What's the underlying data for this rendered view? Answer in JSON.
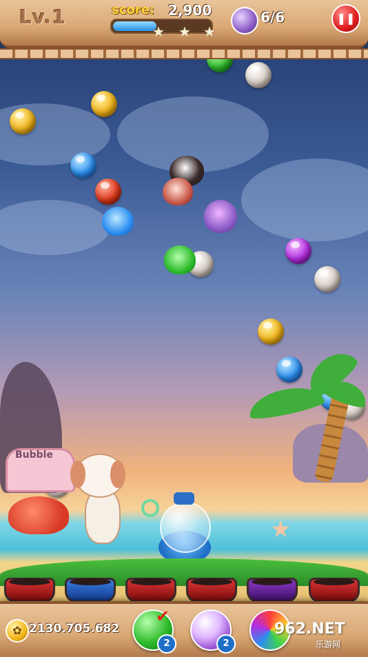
{
  "hud": {
    "level": "Lv.1",
    "score_label": "score:",
    "score_value": "2,900",
    "score_progress": 0.45,
    "stars": 3,
    "birds_count": "6/6",
    "pause_icon": "pause-icon"
  },
  "playfield": {
    "bubbles": [
      {
        "color": "yellow"
      },
      {
        "color": "yellow"
      },
      {
        "color": "blue"
      },
      {
        "color": "red"
      },
      {
        "color": "green"
      },
      {
        "color": "white"
      },
      {
        "color": "purple"
      },
      {
        "color": "white"
      },
      {
        "color": "yellow"
      },
      {
        "color": "blue"
      },
      {
        "color": "blue"
      },
      {
        "color": "white"
      },
      {
        "color": "white"
      },
      {
        "color": "white"
      }
    ],
    "birds_trapped": 5
  },
  "scene": {
    "sign_text": "Bubble"
  },
  "bottom": {
    "coins": "2130.705.682",
    "tools": [
      {
        "name": "aim-line",
        "count": "2"
      },
      {
        "name": "bomb-bubble",
        "count": "2"
      },
      {
        "name": "rainbow-bubble",
        "count": ""
      }
    ]
  },
  "watermark": {
    "main": "962.NET",
    "sub": "乐游网"
  },
  "colors": {
    "wood": "#d9a874",
    "score_yellow": "#ffd23b",
    "pause_red": "#e01c1c"
  }
}
